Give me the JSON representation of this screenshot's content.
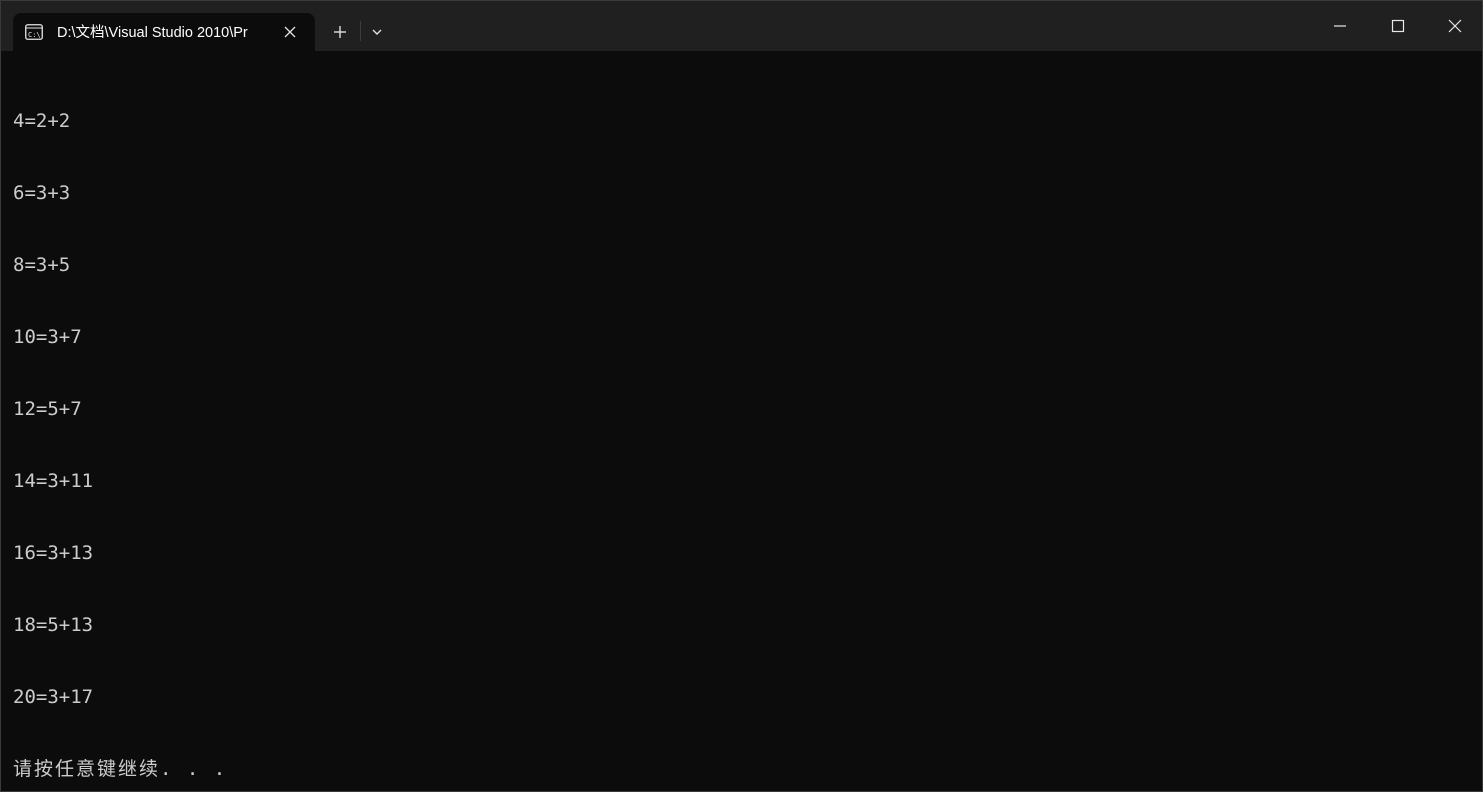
{
  "window": {
    "tab_title": "D:\\文档\\Visual Studio 2010\\Pr",
    "tab_icon": "console-icon",
    "background_color": "#0c0c0c",
    "titlebar_color": "#202020",
    "text_color": "#cccccc"
  },
  "titlebar": {
    "new_tab_icon": "plus-icon",
    "dropdown_icon": "chevron-down-icon",
    "minimize_icon": "minimize-icon",
    "maximize_icon": "maximize-icon",
    "close_icon": "close-icon"
  },
  "console": {
    "lines": [
      "4=2+2",
      "6=3+3",
      "8=3+5",
      "10=3+7",
      "12=5+7",
      "14=3+11",
      "16=3+13",
      "18=5+13",
      "20=3+17"
    ],
    "prompt": "请按任意键继续. . ."
  }
}
